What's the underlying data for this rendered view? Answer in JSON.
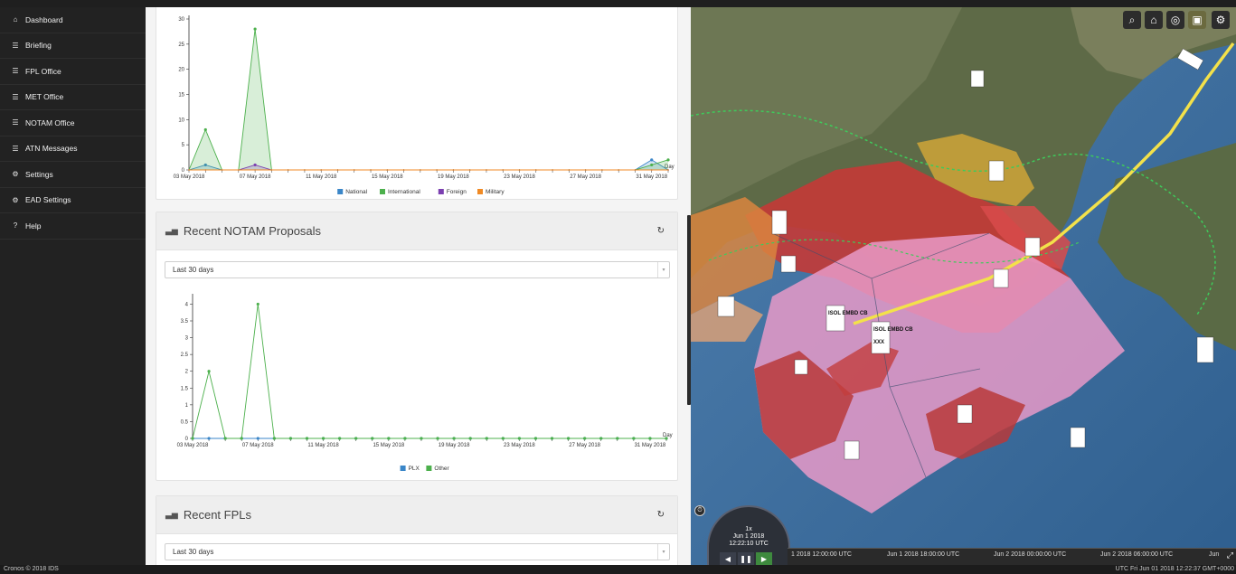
{
  "sidebar": {
    "items": [
      {
        "label": "Dashboard",
        "icon": "home-icon"
      },
      {
        "label": "Briefing",
        "icon": "list-icon"
      },
      {
        "label": "FPL Office",
        "icon": "list-icon"
      },
      {
        "label": "MET Office",
        "icon": "list-icon"
      },
      {
        "label": "NOTAM Office",
        "icon": "list-icon"
      },
      {
        "label": "ATN Messages",
        "icon": "list-icon"
      },
      {
        "label": "Settings",
        "icon": "gear-icon"
      },
      {
        "label": "EAD Settings",
        "icon": "gear-icon"
      },
      {
        "label": "Help",
        "icon": "question-icon"
      }
    ]
  },
  "panels": {
    "notam_proposals": {
      "title": "Recent NOTAM Proposals",
      "select_value": "Last 30 days"
    },
    "fpls": {
      "title": "Recent FPLs",
      "select_value": "Last 30 days"
    }
  },
  "chart_data": [
    {
      "type": "area",
      "xlabel": "Day",
      "x_tick_labels": [
        "03 May 2018",
        "07 May 2018",
        "11 May 2018",
        "15 May 2018",
        "19 May 2018",
        "23 May 2018",
        "27 May 2018",
        "31 May 2018"
      ],
      "y_ticks": [
        0,
        5,
        10,
        15,
        20,
        25,
        30
      ],
      "ylim": [
        0,
        30
      ],
      "x": [
        0,
        1,
        2,
        3,
        4,
        5,
        6,
        7,
        8,
        9,
        10,
        11,
        12,
        13,
        14,
        15,
        16,
        17,
        18,
        19,
        20,
        21,
        22,
        23,
        24,
        25,
        26,
        27,
        28,
        29
      ],
      "series": [
        {
          "name": "National",
          "color": "#3a86c8",
          "values": [
            0,
            1,
            0,
            0,
            0,
            0,
            0,
            0,
            0,
            0,
            0,
            0,
            0,
            0,
            0,
            0,
            0,
            0,
            0,
            0,
            0,
            0,
            0,
            0,
            0,
            0,
            0,
            0,
            2,
            0
          ]
        },
        {
          "name": "International",
          "color": "#4cb04c",
          "values": [
            0,
            8,
            0,
            0,
            28,
            0,
            0,
            0,
            0,
            0,
            0,
            0,
            0,
            0,
            0,
            0,
            0,
            0,
            0,
            0,
            0,
            0,
            0,
            0,
            0,
            0,
            0,
            0,
            1,
            2
          ]
        },
        {
          "name": "Foreign",
          "color": "#7b3fb0",
          "values": [
            0,
            0,
            0,
            0,
            1,
            0,
            0,
            0,
            0,
            0,
            0,
            0,
            0,
            0,
            0,
            0,
            0,
            0,
            0,
            0,
            0,
            0,
            0,
            0,
            0,
            0,
            0,
            0,
            0,
            0
          ]
        },
        {
          "name": "Military",
          "color": "#f08a24",
          "values": [
            0,
            0,
            0,
            0,
            0,
            0,
            0,
            0,
            0,
            0,
            0,
            0,
            0,
            0,
            0,
            0,
            0,
            0,
            0,
            0,
            0,
            0,
            0,
            0,
            0,
            0,
            0,
            0,
            0,
            0
          ]
        }
      ],
      "legend_position": "bottom"
    },
    {
      "type": "line",
      "xlabel": "Day",
      "x_tick_labels": [
        "03 May 2018",
        "07 May 2018",
        "11 May 2018",
        "15 May 2018",
        "19 May 2018",
        "23 May 2018",
        "27 May 2018",
        "31 May 2018"
      ],
      "y_ticks": [
        0,
        0.5,
        1,
        1.5,
        2,
        2.5,
        3,
        3.5,
        4
      ],
      "ylim": [
        0,
        4.2
      ],
      "x": [
        0,
        1,
        2,
        3,
        4,
        5,
        6,
        7,
        8,
        9,
        10,
        11,
        12,
        13,
        14,
        15,
        16,
        17,
        18,
        19,
        20,
        21,
        22,
        23,
        24,
        25,
        26,
        27,
        28,
        29
      ],
      "series": [
        {
          "name": "PLX",
          "color": "#3a86c8",
          "values": [
            0,
            0,
            0,
            0,
            0,
            0,
            0,
            0,
            0,
            0,
            0,
            0,
            0,
            0,
            0,
            0,
            0,
            0,
            0,
            0,
            0,
            0,
            0,
            0,
            0,
            0,
            0,
            0,
            0,
            0
          ]
        },
        {
          "name": "Other",
          "color": "#4cb04c",
          "values": [
            0,
            2,
            0,
            0,
            4,
            0,
            0,
            0,
            0,
            0,
            0,
            0,
            0,
            0,
            0,
            0,
            0,
            0,
            0,
            0,
            0,
            0,
            0,
            0,
            0,
            0,
            0,
            0,
            0,
            0
          ]
        }
      ],
      "legend_position": "bottom"
    }
  ],
  "map": {
    "clock": {
      "speed": "1x",
      "date": "Jun 1 2018",
      "time": "12:22:10 UTC"
    },
    "timeline_labels": [
      "1 2018 12:00:00 UTC",
      "Jun 1 2018 18:00:00 UTC",
      "Jun 2 2018 00:00:00 UTC",
      "Jun 2 2018 06:00:00 UTC",
      "Jun"
    ],
    "labels": [
      "ISOL EMBD CB",
      "ISOL EMBD CB",
      "XXX"
    ]
  },
  "footer": {
    "left": "Cronos © 2018 IDS",
    "right": "UTC Fri Jun 01 2018 12:22:37 GMT+0000"
  }
}
